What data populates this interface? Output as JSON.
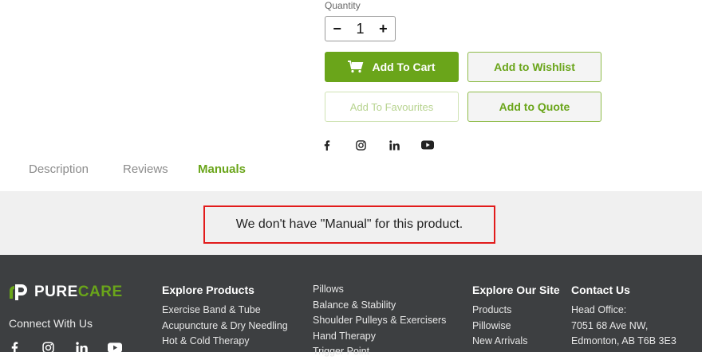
{
  "quantity": {
    "label": "Quantity",
    "value": "1",
    "minus": "−",
    "plus": "+"
  },
  "buttons": {
    "add_to_cart": "Add To Cart",
    "add_to_wishlist": "Add to Wishlist",
    "add_to_favourites": "Add To Favourites",
    "add_to_quote": "Add to Quote"
  },
  "product_social": [
    "facebook-icon",
    "instagram-icon",
    "linkedin-icon",
    "youtube-icon"
  ],
  "tabs": [
    {
      "label": "Description",
      "active": false
    },
    {
      "label": "Reviews",
      "active": false
    },
    {
      "label": "Manuals",
      "active": true
    }
  ],
  "manual_notice": "We don't have \"Manual\" for this product.",
  "footer": {
    "logo": {
      "pure": "PURE",
      "care": "CARE"
    },
    "connect": "Connect With Us",
    "explore_products": {
      "title": "Explore Products",
      "items": [
        "Exercise Band & Tube",
        "Acupuncture & Dry Needling",
        "Hot & Cold Therapy"
      ]
    },
    "categories": {
      "items": [
        "Pillows",
        "Balance & Stability",
        "Shoulder Pulleys & Exercisers",
        "Hand Therapy",
        "Trigger Point"
      ]
    },
    "explore_site": {
      "title": "Explore Our Site",
      "items": [
        "Products",
        "Pillowise",
        "New Arrivals"
      ]
    },
    "contact": {
      "title": "Contact Us",
      "items": [
        "Head Office:",
        "7051 68 Ave NW,",
        "Edmonton, AB T6B 3E3"
      ]
    }
  },
  "colors": {
    "brand_green": "#6aa51a",
    "footer_bg": "#3d3f41",
    "notice_border": "#e21b1b"
  }
}
